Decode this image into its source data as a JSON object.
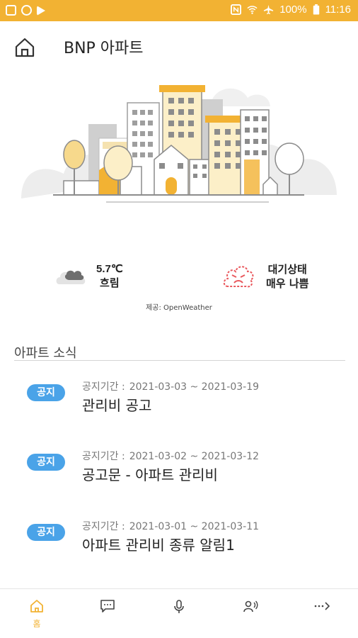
{
  "status_bar": {
    "battery": "100%",
    "time": "11:16",
    "left_icons": [
      "screenshot-icon",
      "data-saver-icon",
      "play-store-icon"
    ],
    "right_icons": [
      "nfc-icon",
      "wifi-icon",
      "airplane-icon",
      "battery-icon"
    ]
  },
  "header": {
    "title": "BNP 아파트",
    "home_icon": "home-icon"
  },
  "weather": {
    "temperature": "5.7℃",
    "condition": "흐림",
    "weather_icon": "cloud-icon",
    "air_label": "대기상태",
    "air_status": "매우 나쁨",
    "air_icon": "angry-cloud-icon",
    "provider": "제공: OpenWeather"
  },
  "news": {
    "section_title": "아파트 소식",
    "items": [
      {
        "badge": "공지",
        "period_label": "공지기간 :",
        "period": "2021-03-03 ~ 2021-03-19",
        "title": "관리비 공고"
      },
      {
        "badge": "공지",
        "period_label": "공지기간 :",
        "period": "2021-03-02 ~ 2021-03-12",
        "title": "공고문 - 아파트 관리비"
      },
      {
        "badge": "공지",
        "period_label": "공지기간 :",
        "period": "2021-03-01 ~ 2021-03-11",
        "title": "아파트 관리비 종류 알림1"
      }
    ]
  },
  "bottom_nav": {
    "items": [
      {
        "label": "홈",
        "icon": "home-icon",
        "active": true
      },
      {
        "label": "",
        "icon": "chat-icon"
      },
      {
        "label": "",
        "icon": "microphone-icon"
      },
      {
        "label": "",
        "icon": "visitor-icon"
      },
      {
        "label": "",
        "icon": "more-icon"
      }
    ]
  },
  "colors": {
    "accent": "#f2b233",
    "badge": "#4aa3e8",
    "air_bad": "#e9595e"
  }
}
